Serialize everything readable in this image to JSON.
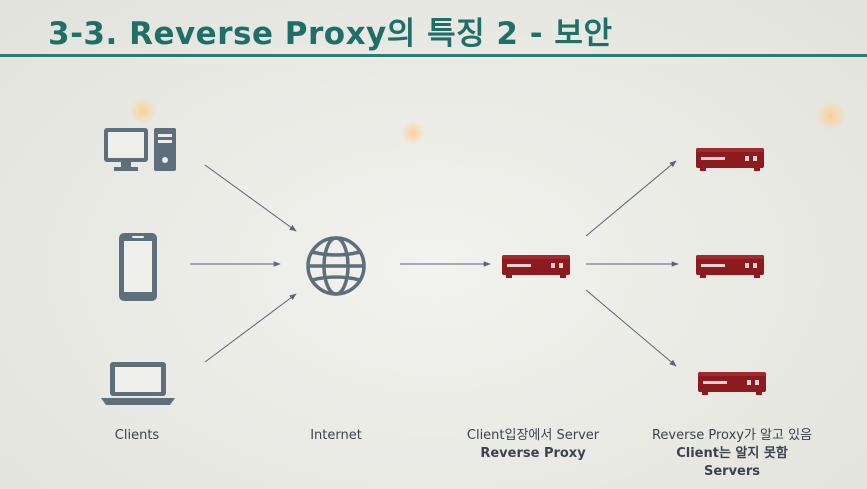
{
  "title": "3-3. Reverse Proxy의 특징 2 - 보안",
  "labels": {
    "clients": "Clients",
    "internet": "Internet",
    "proxy_line1": "Client입장에서 Server",
    "proxy_line2": "Reverse Proxy",
    "servers_line1": "Reverse Proxy가 알고 있음",
    "servers_line2": "Client는 알지 못함",
    "servers_line3": "Servers"
  },
  "colors": {
    "title": "#1f6e68",
    "device": "#5e6f7c",
    "server": "#8c1a1e",
    "arrow": "#5a6472"
  },
  "icons": [
    "desktop-icon",
    "phone-icon",
    "laptop-icon",
    "globe-icon",
    "server-icon"
  ]
}
